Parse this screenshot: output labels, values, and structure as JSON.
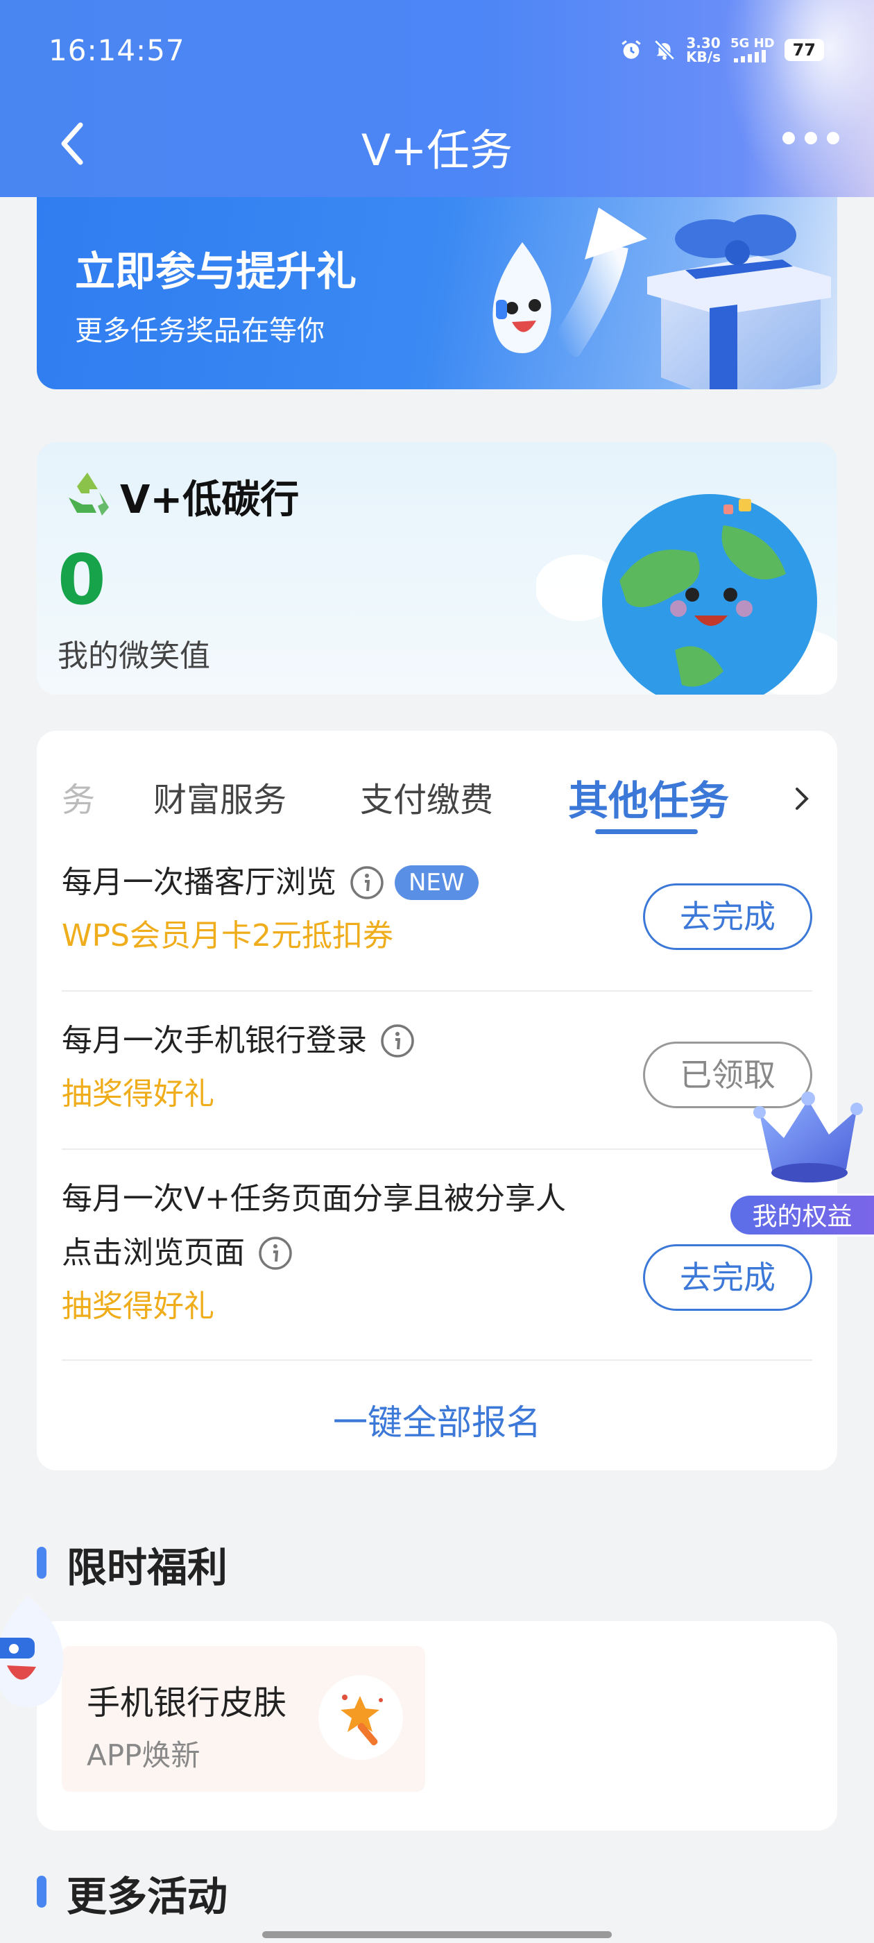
{
  "status_bar": {
    "time": "16:14:57",
    "speed_value": "3.30",
    "speed_unit": "KB/s",
    "network": "5G HD",
    "battery": "77",
    "icons": [
      "alarm-icon",
      "mute-icon",
      "signal-icon"
    ]
  },
  "nav": {
    "title": "V+任务",
    "back_icon": "back-arrow-icon",
    "more_icon": "more-dots-icon"
  },
  "banner": {
    "title": "立即参与提升礼",
    "subtitle": "更多任务奖品在等你"
  },
  "carbon": {
    "title": "V+低碳行",
    "value": "0",
    "label": "我的微笑值"
  },
  "tasks": {
    "tabs": [
      {
        "label": "务",
        "state": "faded"
      },
      {
        "label": "财富服务",
        "state": "normal"
      },
      {
        "label": "支付缴费",
        "state": "normal"
      },
      {
        "label": "其他任务",
        "state": "active"
      }
    ],
    "items": [
      {
        "name": "每月一次播客厅浏览",
        "badge": "NEW",
        "reward": "WPS会员月卡2元抵扣券",
        "button": "去完成",
        "button_state": "active"
      },
      {
        "name": "每月一次手机银行登录",
        "reward": "抽奖得好礼",
        "button": "已领取",
        "button_state": "done"
      },
      {
        "name_line1": "每月一次V+任务页面分享且被分享人",
        "name_line2": "点击浏览页面",
        "reward": "抽奖得好礼",
        "button": "去完成",
        "button_state": "active"
      }
    ],
    "signup_all": "一键全部报名"
  },
  "floating": {
    "rights_label": "我的权益"
  },
  "perks_section": {
    "title": "限时福利",
    "card": {
      "title": "手机银行皮肤",
      "subtitle": "APP焕新"
    }
  },
  "more_section": {
    "title": "更多活动"
  },
  "colors": {
    "brand_blue": "#4a86f2",
    "link_blue": "#3c78d8",
    "reward_orange": "#f0ad1b",
    "carbon_green": "#16a34a"
  }
}
